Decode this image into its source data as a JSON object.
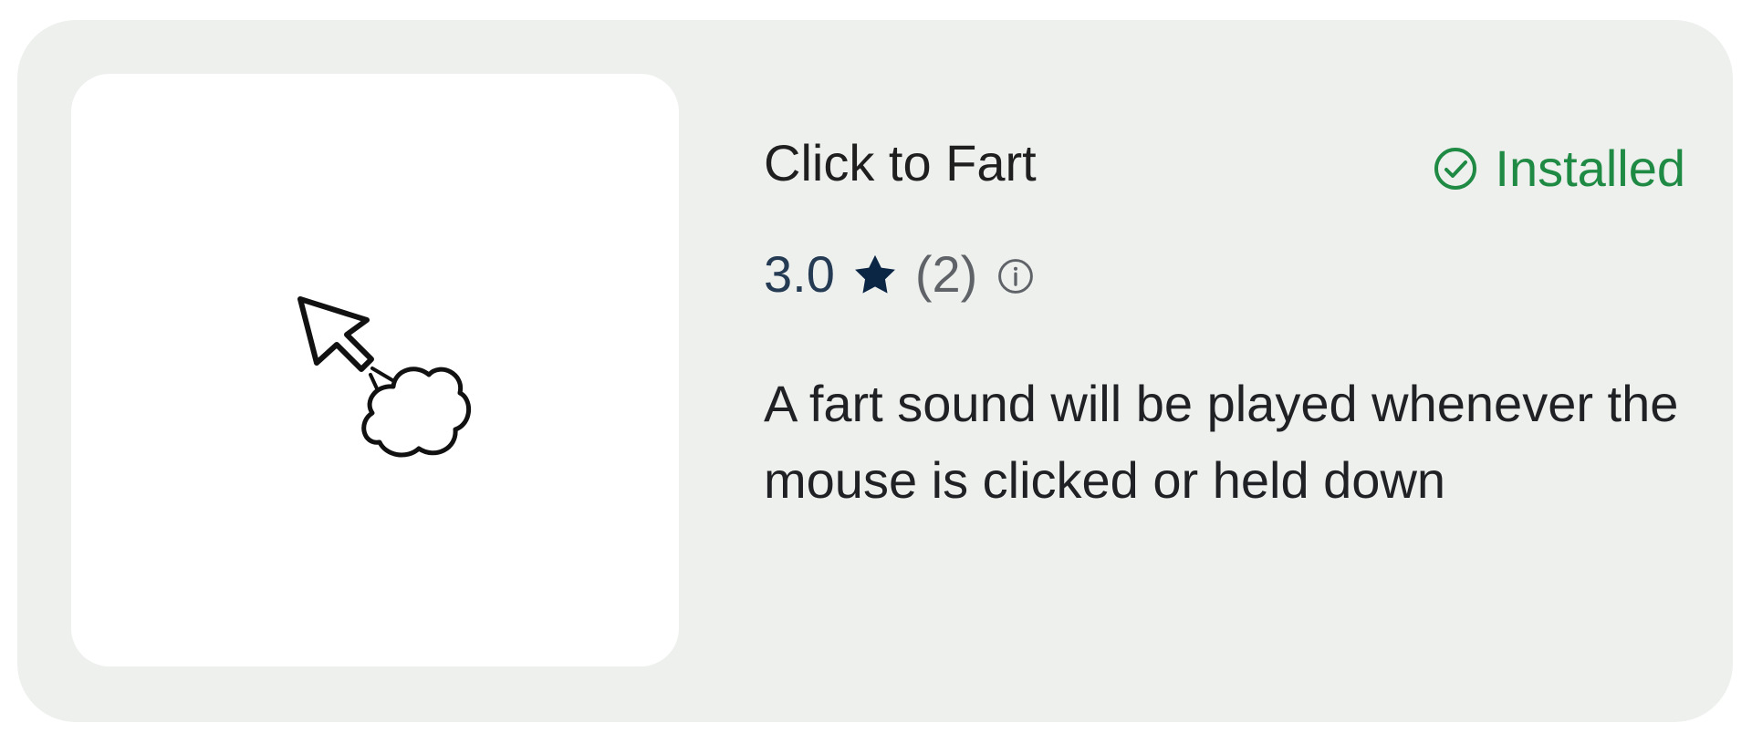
{
  "card": {
    "title": "Click to Fart",
    "status": {
      "label": "Installed",
      "icon": "check-circle-icon",
      "color": "#1f8a43"
    },
    "rating": {
      "value": "3.0",
      "stars_icon": "star-icon",
      "count": "(2)",
      "info_icon": "info-icon"
    },
    "description": "A fart sound will be played whenever the mouse is clicked or held down",
    "thumbnail": {
      "icon": "mouse-cursor-fart-cloud-icon"
    }
  }
}
